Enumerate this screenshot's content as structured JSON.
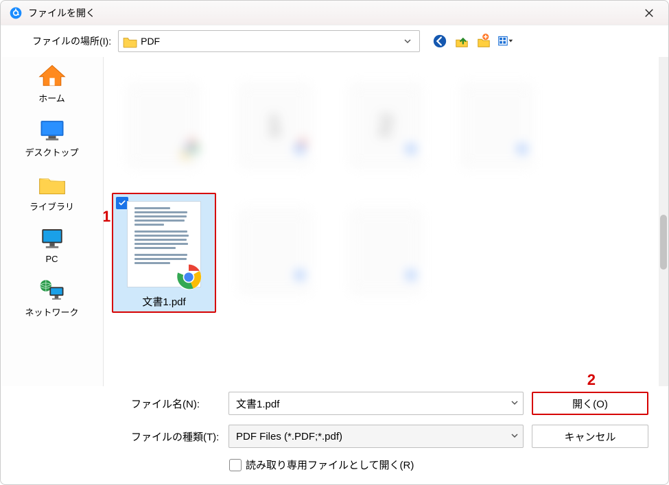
{
  "window": {
    "title": "ファイルを開く"
  },
  "location": {
    "label": "ファイルの場所(I):",
    "value": "PDF"
  },
  "toolbar_icons": {
    "back": "back-icon",
    "up": "up-icon",
    "new_folder": "new-folder-icon",
    "view": "view-menu-icon"
  },
  "places": [
    {
      "label": "ホーム"
    },
    {
      "label": "デスクトップ"
    },
    {
      "label": "ライブラリ"
    },
    {
      "label": "PC"
    },
    {
      "label": "ネットワーク"
    }
  ],
  "selected_file": {
    "name": "文書1.pdf"
  },
  "annotations": {
    "one": "1",
    "two": "2"
  },
  "footer": {
    "filename_label": "ファイル名(N):",
    "filename_value": "文書1.pdf",
    "filetype_label": "ファイルの種類(T):",
    "filetype_value": "PDF Files (*.PDF;*.pdf)",
    "open_button": "開く(O)",
    "cancel_button": "キャンセル",
    "readonly_label": "読み取り専用ファイルとして開く(R)"
  }
}
